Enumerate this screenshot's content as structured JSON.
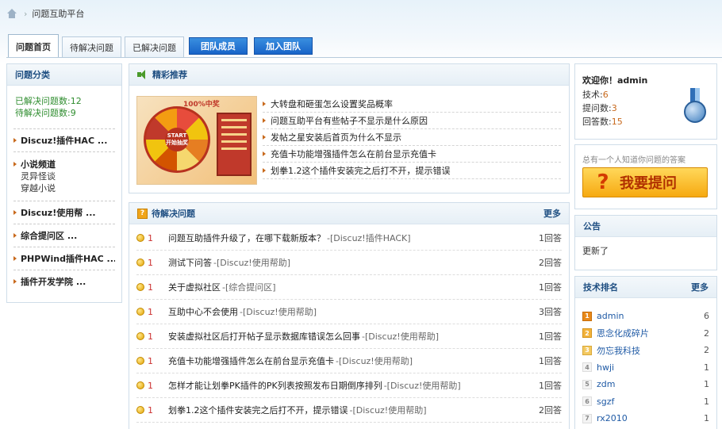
{
  "breadcrumb": {
    "separator": "›",
    "current": "问题互助平台"
  },
  "tabs": [
    {
      "label": "问题首页",
      "active": true
    },
    {
      "label": "待解决问题",
      "active": false
    },
    {
      "label": "已解决问题",
      "active": false
    }
  ],
  "tab_buttons": [
    {
      "label": "团队成员"
    },
    {
      "label": "加入团队"
    }
  ],
  "left": {
    "title": "问题分类",
    "solved": "已解决问题数:12",
    "pending": "待解决问题数:9",
    "categories": [
      {
        "name": "Discuz!插件HAC ...",
        "subs": []
      },
      {
        "name": "小说频道",
        "subs": [
          "灵异怪谈",
          "穿越小说"
        ]
      },
      {
        "name": "Discuz!使用帮 ...",
        "subs": []
      },
      {
        "name": "综合提问区 ...",
        "subs": []
      },
      {
        "name": "PHPWind插件HAC ...",
        "subs": []
      },
      {
        "name": "插件开发学院 ...",
        "subs": []
      }
    ]
  },
  "featured": {
    "title": "精彩推荐",
    "promo": {
      "top_text": "100%中奖",
      "start": "START",
      "sub": "开始抽奖"
    },
    "items": [
      "大转盘和砸蛋怎么设置奖品概率",
      "问题互助平台有些帖子不显示是什么原因",
      "发帖之星安装后首页为什么不显示",
      "充值卡功能增强插件怎么在前台显示充值卡",
      "划拳1.2这个插件安装完之后打不开，提示错误"
    ]
  },
  "pending": {
    "title": "待解决问题",
    "more": "更多",
    "questions": [
      {
        "reward": "1",
        "title": "问题互助插件升级了，在哪下载新版本？",
        "category": "-[Discuz!插件HACK]",
        "answers": "1回答"
      },
      {
        "reward": "1",
        "title": "测试下问答",
        "category": "-[Discuz!使用帮助]",
        "answers": "2回答"
      },
      {
        "reward": "1",
        "title": "关于虚拟社区",
        "category": "-[综合提问区]",
        "answers": "1回答"
      },
      {
        "reward": "1",
        "title": "互助中心不会使用",
        "category": "-[Discuz!使用帮助]",
        "answers": "3回答"
      },
      {
        "reward": "1",
        "title": "安装虚拟社区后打开帖子显示数据库错误怎么回事",
        "category": "-[Discuz!使用帮助]",
        "answers": "1回答"
      },
      {
        "reward": "1",
        "title": "充值卡功能增强插件怎么在前台显示充值卡",
        "category": "-[Discuz!使用帮助]",
        "answers": "1回答"
      },
      {
        "reward": "1",
        "title": "怎样才能让划拳PK插件的PK列表按照发布日期倒序排列",
        "category": "-[Discuz!使用帮助]",
        "answers": "1回答"
      },
      {
        "reward": "1",
        "title": "划拳1.2这个插件安装完之后打不开，提示错误",
        "category": "-[Discuz!使用帮助]",
        "answers": "2回答"
      }
    ]
  },
  "user": {
    "welcome": "欢迎你！admin",
    "skill_label": "技术:",
    "skill": "6",
    "questions_label": "提问数:",
    "questions": "3",
    "answers_label": "回答数:",
    "answers": "15"
  },
  "ask": {
    "hint": "总有一个人知道你问题的答案",
    "icon": "?",
    "label": "我要提问"
  },
  "notice": {
    "title": "公告",
    "text": "更新了"
  },
  "ranking": {
    "title": "技术排名",
    "more": "更多",
    "rows": [
      {
        "rank": "1",
        "name": "admin",
        "score": "6"
      },
      {
        "rank": "2",
        "name": "思念化成碎片",
        "score": "2"
      },
      {
        "rank": "3",
        "name": "勿忘我科技",
        "score": "2"
      },
      {
        "rank": "4",
        "name": "hwji",
        "score": "1"
      },
      {
        "rank": "5",
        "name": "zdm",
        "score": "1"
      },
      {
        "rank": "6",
        "name": "sgzf",
        "score": "1"
      },
      {
        "rank": "7",
        "name": "rx2010",
        "score": "1"
      }
    ]
  }
}
